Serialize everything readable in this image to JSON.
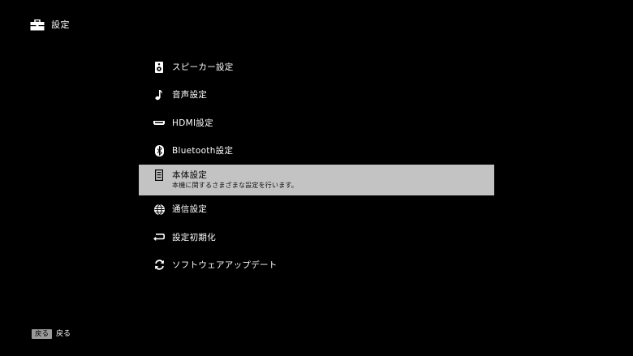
{
  "header": {
    "icon": "toolbox-icon",
    "title": "設定"
  },
  "menu": {
    "items": [
      {
        "icon": "speaker-icon",
        "label": "スピーカー設定",
        "selected": false
      },
      {
        "icon": "music-note-icon",
        "label": "音声設定",
        "selected": false
      },
      {
        "icon": "hdmi-icon",
        "label": "HDMI設定",
        "selected": false
      },
      {
        "icon": "bluetooth-icon",
        "label": "Bluetooth設定",
        "selected": false
      },
      {
        "icon": "device-icon",
        "label": "本体設定",
        "description": "本機に関するさまざまな設定を行います。",
        "selected": true
      },
      {
        "icon": "globe-icon",
        "label": "通信設定",
        "selected": false
      },
      {
        "icon": "reset-icon",
        "label": "設定初期化",
        "selected": false
      },
      {
        "icon": "update-icon",
        "label": "ソフトウェアアップデート",
        "selected": false
      }
    ]
  },
  "footer": {
    "back_key": "戻る",
    "back_label": "戻る"
  },
  "colors": {
    "background": "#000000",
    "selected_background": "#c3c3c3",
    "text": "#ffffff",
    "key_background": "#9a9a9a"
  }
}
